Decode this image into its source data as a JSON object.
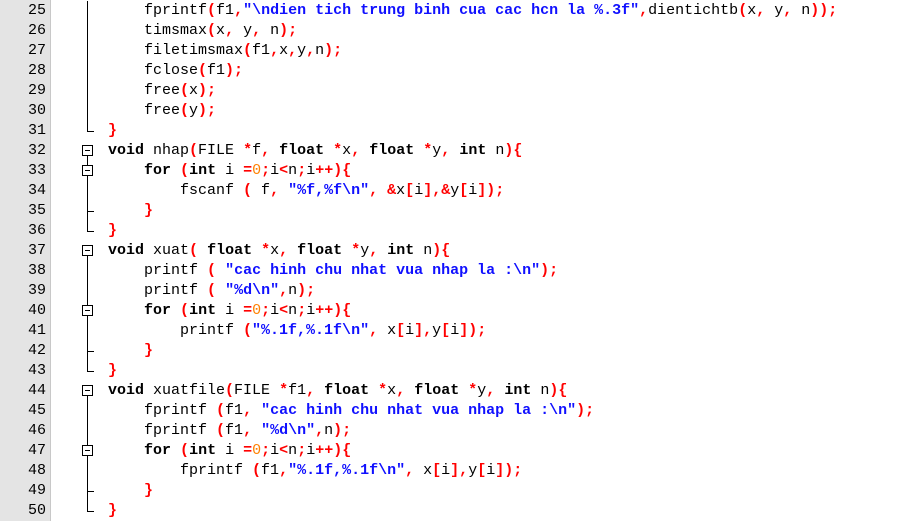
{
  "editor": {
    "lines": [
      {
        "n": "25",
        "fold": "line",
        "tokens": [
          [
            "t",
            "    fprintf"
          ],
          [
            "o",
            "("
          ],
          [
            "t",
            "f1"
          ],
          [
            "o",
            ","
          ],
          [
            "s",
            "\"\\ndien tich trung binh cua cac hcn la %.3f\""
          ],
          [
            "o",
            ","
          ],
          [
            "t",
            "dientichtb"
          ],
          [
            "o",
            "("
          ],
          [
            "t",
            "x"
          ],
          [
            "o",
            ","
          ],
          [
            "t",
            " y"
          ],
          [
            "o",
            ","
          ],
          [
            "t",
            " n"
          ],
          [
            "o",
            "));"
          ]
        ]
      },
      {
        "n": "26",
        "fold": "line",
        "tokens": [
          [
            "t",
            "    timsmax"
          ],
          [
            "o",
            "("
          ],
          [
            "t",
            "x"
          ],
          [
            "o",
            ","
          ],
          [
            "t",
            " y"
          ],
          [
            "o",
            ","
          ],
          [
            "t",
            " n"
          ],
          [
            "o",
            ");"
          ]
        ]
      },
      {
        "n": "27",
        "fold": "line",
        "tokens": [
          [
            "t",
            "    filetimsmax"
          ],
          [
            "o",
            "("
          ],
          [
            "t",
            "f1"
          ],
          [
            "o",
            ","
          ],
          [
            "t",
            "x"
          ],
          [
            "o",
            ","
          ],
          [
            "t",
            "y"
          ],
          [
            "o",
            ","
          ],
          [
            "t",
            "n"
          ],
          [
            "o",
            ");"
          ]
        ]
      },
      {
        "n": "28",
        "fold": "line",
        "tokens": [
          [
            "t",
            "    fclose"
          ],
          [
            "o",
            "("
          ],
          [
            "t",
            "f1"
          ],
          [
            "o",
            ");"
          ]
        ]
      },
      {
        "n": "29",
        "fold": "line",
        "tokens": [
          [
            "t",
            "    free"
          ],
          [
            "o",
            "("
          ],
          [
            "t",
            "x"
          ],
          [
            "o",
            ");"
          ]
        ]
      },
      {
        "n": "30",
        "fold": "line",
        "tokens": [
          [
            "t",
            "    free"
          ],
          [
            "o",
            "("
          ],
          [
            "t",
            "y"
          ],
          [
            "o",
            ");"
          ]
        ]
      },
      {
        "n": "31",
        "fold": "end",
        "tokens": [
          [
            "o",
            "}"
          ]
        ]
      },
      {
        "n": "32",
        "fold": "box",
        "tokens": [
          [
            "k",
            "void"
          ],
          [
            "t",
            " nhap"
          ],
          [
            "o",
            "("
          ],
          [
            "t",
            "FILE "
          ],
          [
            "o",
            "*"
          ],
          [
            "t",
            "f"
          ],
          [
            "o",
            ","
          ],
          [
            "t",
            " "
          ],
          [
            "k",
            "float"
          ],
          [
            "t",
            " "
          ],
          [
            "o",
            "*"
          ],
          [
            "t",
            "x"
          ],
          [
            "o",
            ","
          ],
          [
            "t",
            " "
          ],
          [
            "k",
            "float"
          ],
          [
            "t",
            " "
          ],
          [
            "o",
            "*"
          ],
          [
            "t",
            "y"
          ],
          [
            "o",
            ","
          ],
          [
            "t",
            " "
          ],
          [
            "k",
            "int"
          ],
          [
            "t",
            " n"
          ],
          [
            "o",
            "){"
          ]
        ]
      },
      {
        "n": "33",
        "fold": "box-inner",
        "tokens": [
          [
            "t",
            "    "
          ],
          [
            "k",
            "for"
          ],
          [
            "t",
            " "
          ],
          [
            "o",
            "("
          ],
          [
            "k",
            "int"
          ],
          [
            "t",
            " i "
          ],
          [
            "o",
            "="
          ],
          [
            "c",
            "0"
          ],
          [
            "o",
            ";"
          ],
          [
            "t",
            "i"
          ],
          [
            "o",
            "<"
          ],
          [
            "t",
            "n"
          ],
          [
            "o",
            ";"
          ],
          [
            "t",
            "i"
          ],
          [
            "o",
            "++){"
          ]
        ]
      },
      {
        "n": "34",
        "fold": "inner-line",
        "tokens": [
          [
            "t",
            "        fscanf "
          ],
          [
            "o",
            "("
          ],
          [
            "t",
            " f"
          ],
          [
            "o",
            ","
          ],
          [
            "t",
            " "
          ],
          [
            "s",
            "\"%f,%f\\n\""
          ],
          [
            "o",
            ","
          ],
          [
            "t",
            " "
          ],
          [
            "o",
            "&"
          ],
          [
            "t",
            "x"
          ],
          [
            "o",
            "["
          ],
          [
            "t",
            "i"
          ],
          [
            "o",
            "],&"
          ],
          [
            "t",
            "y"
          ],
          [
            "o",
            "["
          ],
          [
            "t",
            "i"
          ],
          [
            "o",
            "]);"
          ]
        ]
      },
      {
        "n": "35",
        "fold": "inner-end",
        "tokens": [
          [
            "t",
            "    "
          ],
          [
            "o",
            "}"
          ]
        ]
      },
      {
        "n": "36",
        "fold": "end",
        "tokens": [
          [
            "o",
            "}"
          ]
        ]
      },
      {
        "n": "37",
        "fold": "box",
        "tokens": [
          [
            "k",
            "void"
          ],
          [
            "t",
            " xuat"
          ],
          [
            "o",
            "("
          ],
          [
            "t",
            " "
          ],
          [
            "k",
            "float"
          ],
          [
            "t",
            " "
          ],
          [
            "o",
            "*"
          ],
          [
            "t",
            "x"
          ],
          [
            "o",
            ","
          ],
          [
            "t",
            " "
          ],
          [
            "k",
            "float"
          ],
          [
            "t",
            " "
          ],
          [
            "o",
            "*"
          ],
          [
            "t",
            "y"
          ],
          [
            "o",
            ","
          ],
          [
            "t",
            " "
          ],
          [
            "k",
            "int"
          ],
          [
            "t",
            " n"
          ],
          [
            "o",
            "){"
          ]
        ]
      },
      {
        "n": "38",
        "fold": "line",
        "tokens": [
          [
            "t",
            "    printf "
          ],
          [
            "o",
            "("
          ],
          [
            "t",
            " "
          ],
          [
            "s",
            "\"cac hinh chu nhat vua nhap la :\\n\""
          ],
          [
            "o",
            ");"
          ]
        ]
      },
      {
        "n": "39",
        "fold": "line",
        "tokens": [
          [
            "t",
            "    printf "
          ],
          [
            "o",
            "("
          ],
          [
            "t",
            " "
          ],
          [
            "s",
            "\"%d\\n\""
          ],
          [
            "o",
            ","
          ],
          [
            "t",
            "n"
          ],
          [
            "o",
            ");"
          ]
        ]
      },
      {
        "n": "40",
        "fold": "box-inner",
        "tokens": [
          [
            "t",
            "    "
          ],
          [
            "k",
            "for"
          ],
          [
            "t",
            " "
          ],
          [
            "o",
            "("
          ],
          [
            "k",
            "int"
          ],
          [
            "t",
            " i "
          ],
          [
            "o",
            "="
          ],
          [
            "c",
            "0"
          ],
          [
            "o",
            ";"
          ],
          [
            "t",
            "i"
          ],
          [
            "o",
            "<"
          ],
          [
            "t",
            "n"
          ],
          [
            "o",
            ";"
          ],
          [
            "t",
            "i"
          ],
          [
            "o",
            "++){"
          ]
        ]
      },
      {
        "n": "41",
        "fold": "inner-line",
        "tokens": [
          [
            "t",
            "        printf "
          ],
          [
            "o",
            "("
          ],
          [
            "s",
            "\"%.1f,%.1f\\n\""
          ],
          [
            "o",
            ","
          ],
          [
            "t",
            " x"
          ],
          [
            "o",
            "["
          ],
          [
            "t",
            "i"
          ],
          [
            "o",
            "],"
          ],
          [
            "t",
            "y"
          ],
          [
            "o",
            "["
          ],
          [
            "t",
            "i"
          ],
          [
            "o",
            "]);"
          ]
        ]
      },
      {
        "n": "42",
        "fold": "inner-end",
        "tokens": [
          [
            "t",
            "    "
          ],
          [
            "o",
            "}"
          ]
        ]
      },
      {
        "n": "43",
        "fold": "end",
        "tokens": [
          [
            "o",
            "}"
          ]
        ]
      },
      {
        "n": "44",
        "fold": "box",
        "tokens": [
          [
            "k",
            "void"
          ],
          [
            "t",
            " xuatfile"
          ],
          [
            "o",
            "("
          ],
          [
            "t",
            "FILE "
          ],
          [
            "o",
            "*"
          ],
          [
            "t",
            "f1"
          ],
          [
            "o",
            ","
          ],
          [
            "t",
            " "
          ],
          [
            "k",
            "float"
          ],
          [
            "t",
            " "
          ],
          [
            "o",
            "*"
          ],
          [
            "t",
            "x"
          ],
          [
            "o",
            ","
          ],
          [
            "t",
            " "
          ],
          [
            "k",
            "float"
          ],
          [
            "t",
            " "
          ],
          [
            "o",
            "*"
          ],
          [
            "t",
            "y"
          ],
          [
            "o",
            ","
          ],
          [
            "t",
            " "
          ],
          [
            "k",
            "int"
          ],
          [
            "t",
            " n"
          ],
          [
            "o",
            "){"
          ]
        ]
      },
      {
        "n": "45",
        "fold": "line",
        "tokens": [
          [
            "t",
            "    fprintf "
          ],
          [
            "o",
            "("
          ],
          [
            "t",
            "f1"
          ],
          [
            "o",
            ","
          ],
          [
            "t",
            " "
          ],
          [
            "s",
            "\"cac hinh chu nhat vua nhap la :\\n\""
          ],
          [
            "o",
            ");"
          ]
        ]
      },
      {
        "n": "46",
        "fold": "line",
        "tokens": [
          [
            "t",
            "    fprintf "
          ],
          [
            "o",
            "("
          ],
          [
            "t",
            "f1"
          ],
          [
            "o",
            ","
          ],
          [
            "t",
            " "
          ],
          [
            "s",
            "\"%d\\n\""
          ],
          [
            "o",
            ","
          ],
          [
            "t",
            "n"
          ],
          [
            "o",
            ");"
          ]
        ]
      },
      {
        "n": "47",
        "fold": "box-inner",
        "tokens": [
          [
            "t",
            "    "
          ],
          [
            "k",
            "for"
          ],
          [
            "t",
            " "
          ],
          [
            "o",
            "("
          ],
          [
            "k",
            "int"
          ],
          [
            "t",
            " i "
          ],
          [
            "o",
            "="
          ],
          [
            "c",
            "0"
          ],
          [
            "o",
            ";"
          ],
          [
            "t",
            "i"
          ],
          [
            "o",
            "<"
          ],
          [
            "t",
            "n"
          ],
          [
            "o",
            ";"
          ],
          [
            "t",
            "i"
          ],
          [
            "o",
            "++){"
          ]
        ]
      },
      {
        "n": "48",
        "fold": "inner-line",
        "tokens": [
          [
            "t",
            "        fprintf "
          ],
          [
            "o",
            "("
          ],
          [
            "t",
            "f1"
          ],
          [
            "o",
            ","
          ],
          [
            "s",
            "\"%.1f,%.1f\\n\""
          ],
          [
            "o",
            ","
          ],
          [
            "t",
            " x"
          ],
          [
            "o",
            "["
          ],
          [
            "t",
            "i"
          ],
          [
            "o",
            "],"
          ],
          [
            "t",
            "y"
          ],
          [
            "o",
            "["
          ],
          [
            "t",
            "i"
          ],
          [
            "o",
            "]);"
          ]
        ]
      },
      {
        "n": "49",
        "fold": "inner-end",
        "tokens": [
          [
            "t",
            "    "
          ],
          [
            "o",
            "}"
          ]
        ]
      },
      {
        "n": "50",
        "fold": "end",
        "tokens": [
          [
            "o",
            "}"
          ]
        ]
      }
    ]
  }
}
